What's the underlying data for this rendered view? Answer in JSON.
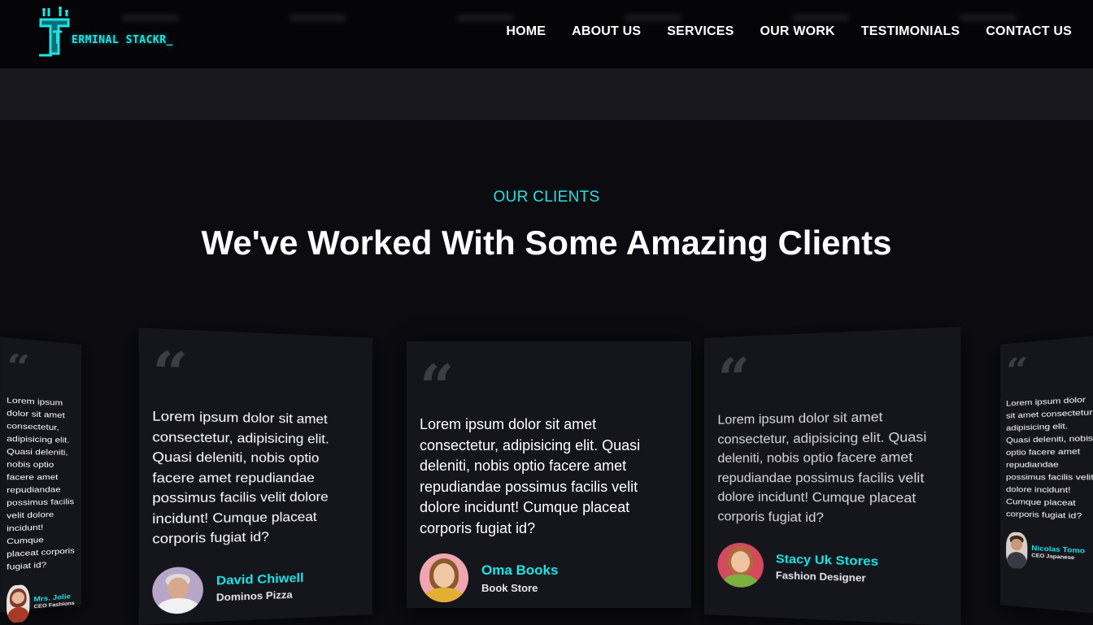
{
  "header": {
    "logo_text": "ERMINAL STACKR_",
    "logo_letter": "T",
    "nav": [
      {
        "label": "HOME"
      },
      {
        "label": "ABOUT US"
      },
      {
        "label": "SERVICES"
      },
      {
        "label": "OUR WORK"
      },
      {
        "label": "TESTIMONIALS"
      },
      {
        "label": "CONTACT US"
      }
    ]
  },
  "section": {
    "eyebrow": "OUR CLIENTS",
    "headline": "We've Worked With Some Amazing Clients"
  },
  "testimonials": [
    {
      "quote_mark": "“",
      "text": "Lorem ipsum dolor sit amet consectetur, adipisicing elit. Quasi deleniti, nobis optio facere amet repudiandae possimus facilis velit dolore incidunt! Cumque placeat corporis fugiat id?",
      "name": "Mrs. Jolie",
      "role": "CEO Fashions"
    },
    {
      "quote_mark": "“",
      "text": "Lorem ipsum dolor sit amet consectetur, adipisicing elit. Quasi deleniti, nobis optio facere amet repudiandae possimus facilis velit dolore incidunt! Cumque placeat corporis fugiat id?",
      "name": "David Chiwell",
      "role": "Dominos Pizza"
    },
    {
      "quote_mark": "“",
      "text": "Lorem ipsum dolor sit amet consectetur, adipisicing elit. Quasi deleniti, nobis optio facere amet repudiandae possimus facilis velit dolore incidunt! Cumque placeat corporis fugiat id?",
      "name": "Oma Books",
      "role": "Book Store"
    },
    {
      "quote_mark": "“",
      "text": "Lorem ipsum dolor sit amet consectetur, adipisicing elit. Quasi deleniti, nobis optio facere amet repudiandae possimus facilis velit dolore incidunt! Cumque placeat corporis fugiat id?",
      "name": "Stacy Uk Stores",
      "role": "Fashion Designer"
    },
    {
      "quote_mark": "“",
      "text": "Lorem ipsum dolor sit amet consectetur, adipisicing elit. Quasi deleniti, nobis optio facere amet repudiandae possimus facilis velit dolore incidunt! Cumque placeat corporis fugiat id?",
      "name": "Nicolas Tomo",
      "role": "CEO Japanese"
    }
  ],
  "colors": {
    "accent": "#1ee3e6",
    "background": "#0b0b10",
    "card": "#15161c",
    "header": "#050507"
  },
  "icons": [
    "logo-icon",
    "quote-icon",
    "avatar-icon"
  ]
}
